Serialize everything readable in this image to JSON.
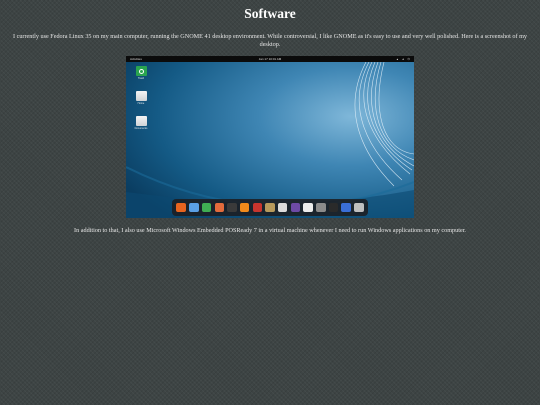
{
  "page": {
    "title": "Software",
    "paragraph1": "I currently use Fedora Linux 35 on my main computer, running the GNOME 41 desktop environment. While controversial, I like GNOME as it's easy to use and very well polished. Here is a screenshot of my desktop.",
    "paragraph2": "In addition to that, I also use Microsoft Windows Embedded POSReady 7 in a virtual machine whenever I need to run Windows applications on my computer."
  },
  "screenshot": {
    "topbar": {
      "activities": "Activities",
      "clock": "Jan 17  10:01 AM",
      "tray_icons": [
        "network-icon",
        "volume-icon",
        "power-icon"
      ]
    },
    "desktop_icons": [
      {
        "label": "Trash",
        "icon": "trash-icon"
      },
      {
        "label": "Home",
        "icon": "home-folder-icon"
      },
      {
        "label": "Documents",
        "icon": "folder-icon"
      }
    ],
    "dock_apps": [
      {
        "icon": "firefox-icon",
        "color": "#e8641f"
      },
      {
        "icon": "files-icon",
        "color": "#5aa0e6"
      },
      {
        "icon": "calc-icon",
        "color": "#3fae53"
      },
      {
        "icon": "impress-icon",
        "color": "#e36b3c"
      },
      {
        "icon": "text-editor-icon",
        "color": "#3a3a3a"
      },
      {
        "icon": "vlc-icon",
        "color": "#f08a1b"
      },
      {
        "icon": "software-center-icon",
        "color": "#c8352e"
      },
      {
        "icon": "gimp-icon",
        "color": "#b79a5c"
      },
      {
        "icon": "screenshot-icon",
        "color": "#dcdcdc"
      },
      {
        "icon": "boxes-icon",
        "color": "#6d4aa6"
      },
      {
        "icon": "camera-icon",
        "color": "#ececec"
      },
      {
        "icon": "settings-icon",
        "color": "#8b8b8b"
      },
      {
        "icon": "terminal-icon",
        "color": "#2a2a2a"
      },
      {
        "icon": "vm-icon",
        "color": "#3a6fd8"
      },
      {
        "icon": "app-grid-icon",
        "color": "#bfbfbf"
      }
    ]
  }
}
